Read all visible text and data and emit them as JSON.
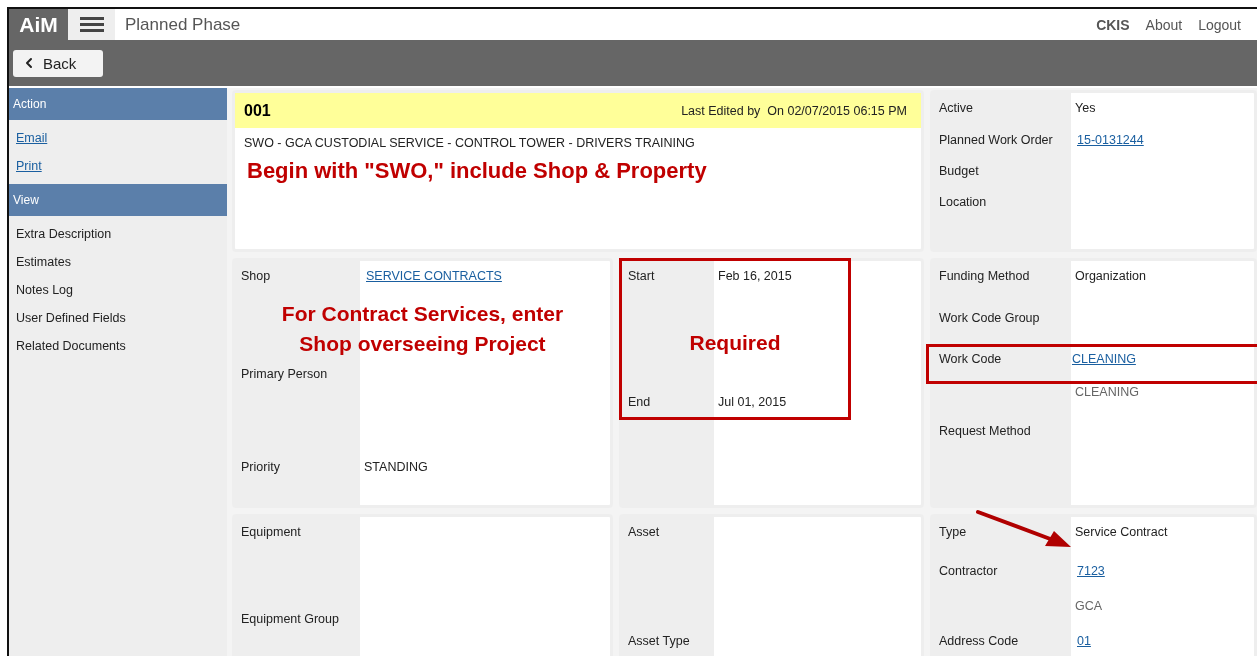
{
  "header": {
    "logo": "AiM",
    "title": "Planned Phase",
    "links": [
      "CKIS",
      "About",
      "Logout"
    ]
  },
  "toolbar": {
    "back_button": "Back"
  },
  "sidebar": {
    "sections": [
      {
        "title": "Action",
        "items": [
          {
            "label": "Email",
            "link": true
          },
          {
            "label": "Print",
            "link": true
          }
        ]
      },
      {
        "title": "View",
        "items": [
          {
            "label": "Extra Description",
            "link": false
          },
          {
            "label": "Estimates",
            "link": false
          },
          {
            "label": "Notes Log",
            "link": false
          },
          {
            "label": "User Defined Fields",
            "link": false
          },
          {
            "label": "Related Documents",
            "link": false
          }
        ]
      }
    ]
  },
  "cards": [
    {
      "kind": "title",
      "number": "001",
      "last_edited": "Last Edited by  On 02/07/2015 06:15 PM",
      "description": "SWO - GCA CUSTODIAL SERVICE - CONTROL TOWER - DRIVERS TRAINING",
      "note": "Begin with \"SWO,\" include Shop & Property"
    },
    {
      "kind": "fields",
      "rows": [
        {
          "kind": "field",
          "label": "Active",
          "value": "Yes",
          "link": false
        },
        {
          "kind": "field",
          "label": "Planned Work Order",
          "value": "15-0131244",
          "link": true
        },
        {
          "kind": "field",
          "label": "Budget"
        },
        {
          "kind": "field",
          "label": "Location"
        }
      ]
    },
    {
      "kind": "fields",
      "rows": [
        {
          "kind": "field",
          "label": "Shop",
          "value": "SERVICE CONTRACTS",
          "link": true
        },
        {
          "kind": "note",
          "lines": [
            "For Contract Services, enter",
            "Shop overseeing Project"
          ]
        },
        {
          "kind": "field",
          "label": "Primary Person"
        },
        {
          "kind": "field",
          "label": "Priority",
          "value": "STANDING",
          "link": false
        }
      ]
    },
    {
      "kind": "fields",
      "highlighted": true,
      "rows": [
        {
          "kind": "field",
          "label": "Start",
          "value": "Feb 16, 2015",
          "link": false
        },
        {
          "kind": "note",
          "lines": [
            "Required"
          ]
        },
        {
          "kind": "field",
          "label": "End",
          "value": "Jul 01, 2015",
          "link": false
        }
      ]
    },
    {
      "kind": "fields",
      "rows": [
        {
          "kind": "field",
          "label": "Funding Method",
          "value": "Organization",
          "link": false
        },
        {
          "kind": "field",
          "label": "Work Code Group"
        },
        {
          "kind": "field",
          "label": "Work Code",
          "value": "CLEANING",
          "link": true,
          "highlighted": true
        },
        {
          "kind": "field",
          "value": "CLEANING",
          "link": false,
          "muted": true
        },
        {
          "kind": "field",
          "label": "Request Method"
        }
      ]
    },
    {
      "kind": "fields",
      "rows": [
        {
          "kind": "field",
          "label": "Equipment"
        },
        {
          "kind": "field",
          "label": "Equipment Group"
        }
      ]
    },
    {
      "kind": "fields",
      "rows": [
        {
          "kind": "field",
          "label": "Asset"
        },
        {
          "kind": "field",
          "label": "Asset Type"
        }
      ]
    },
    {
      "kind": "fields",
      "rows": [
        {
          "kind": "field",
          "label": "Type",
          "value": "Service Contract",
          "link": false,
          "pointer": true
        },
        {
          "kind": "field",
          "label": "Contractor",
          "value": "7123",
          "link": true
        },
        {
          "kind": "field",
          "value": "GCA",
          "link": false,
          "muted": true
        },
        {
          "kind": "field",
          "label": "Address Code",
          "value": "01",
          "link": true
        }
      ]
    }
  ]
}
